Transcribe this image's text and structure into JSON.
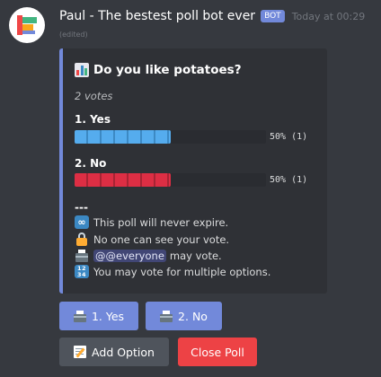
{
  "message": {
    "author": "Paul - The bestest poll bot ever",
    "bot_tag": "BOT",
    "timestamp": "Today at 00:29",
    "edited": "(edited)"
  },
  "poll": {
    "title": "Do you like potatoes?",
    "vote_count": "2 votes",
    "options": [
      {
        "label": "1. Yes",
        "percent_text": "50% (1)",
        "share": 0.5,
        "color": "#55acee"
      },
      {
        "label": "2. No",
        "percent_text": "50% (1)",
        "share": 0.5,
        "color": "#dd2e44"
      }
    ],
    "divider": "---",
    "info": {
      "expire": "This poll will never expire.",
      "private": "No one can see your vote.",
      "mention": "@@everyone",
      "may_vote": "may vote.",
      "multiple": "You may vote for multiple options."
    }
  },
  "buttons": {
    "vote_yes": "1. Yes",
    "vote_no": "2. No",
    "add_option": "Add Option",
    "close_poll": "Close Poll"
  },
  "colors": {
    "accent": "#7289da",
    "danger": "#ed4245",
    "secondary": "#4f545c",
    "background": "#36393f",
    "embed": "#2f3136"
  },
  "icons": [
    "bar-chart-icon",
    "infinity-icon",
    "lock-icon",
    "ballot-box-icon",
    "input-numbers-icon",
    "memo-icon"
  ]
}
